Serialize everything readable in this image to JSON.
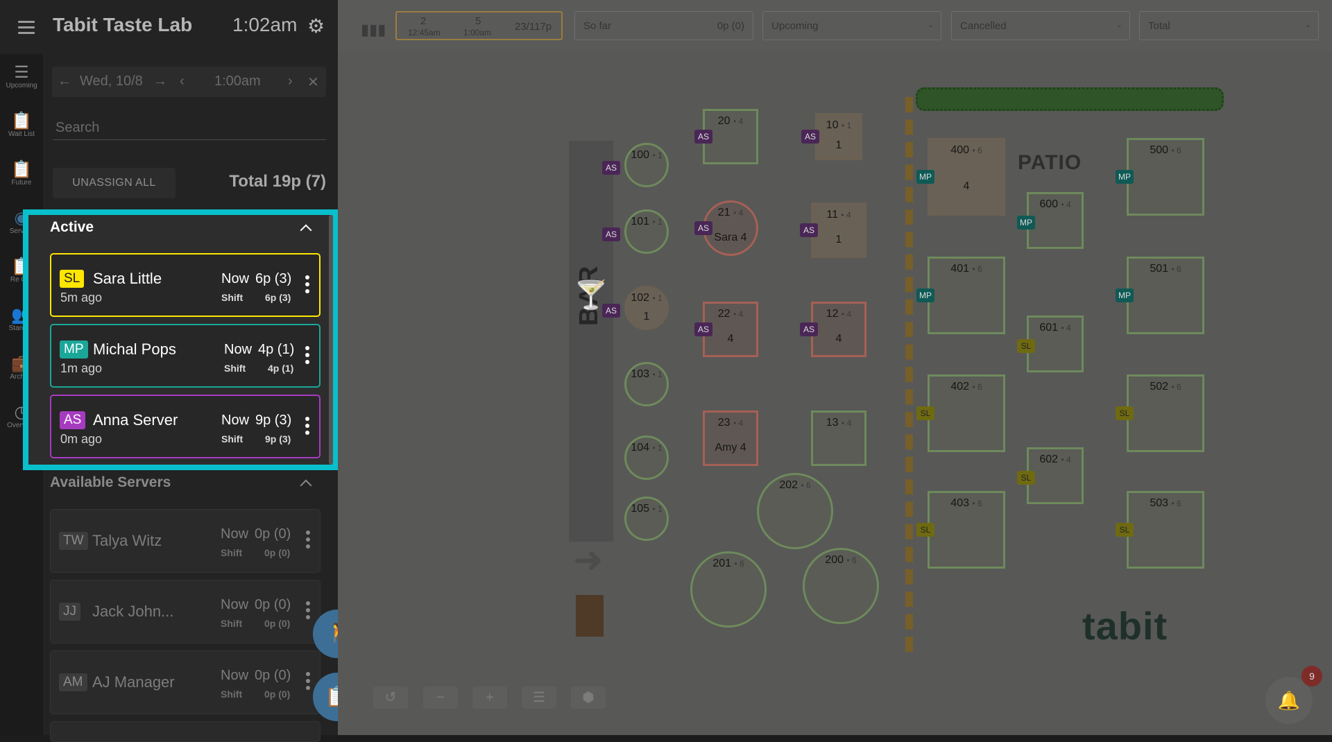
{
  "header": {
    "title": "Tabit Taste Lab",
    "time": "1:02am"
  },
  "rail": [
    {
      "label": "Upcoming"
    },
    {
      "label": "Wait List"
    },
    {
      "label": "Future"
    },
    {
      "label": "Servers"
    },
    {
      "label": "Re Ord"
    },
    {
      "label": "Standby"
    },
    {
      "label": "Archive"
    },
    {
      "label": "Overview"
    }
  ],
  "datebar": {
    "date": "Wed, 10/8",
    "time": "1:00am"
  },
  "search": {
    "placeholder": "Search"
  },
  "actions": {
    "unassign": "UNASSIGN ALL",
    "total": "Total  19p (7)"
  },
  "sections": {
    "active": "Active",
    "available": "Available Servers"
  },
  "active_servers": [
    {
      "initials": "SL",
      "name": "Sara Little",
      "ago": "5m ago",
      "now_label": "Now",
      "now_value": "6p (3)",
      "shift_label": "Shift",
      "shift_value": "6p (3)",
      "color": "#ffe600",
      "text_color": "#222222"
    },
    {
      "initials": "MP",
      "name": "Michal Pops",
      "ago": "1m ago",
      "now_label": "Now",
      "now_value": "4p (1)",
      "shift_label": "Shift",
      "shift_value": "4p (1)",
      "color": "#1aa79a",
      "text_color": "#ffffff"
    },
    {
      "initials": "AS",
      "name": "Anna Server",
      "ago": "0m ago",
      "now_label": "Now",
      "now_value": "9p (3)",
      "shift_label": "Shift",
      "shift_value": "9p (3)",
      "color": "#a73bc0",
      "text_color": "#ffffff"
    }
  ],
  "available_servers": [
    {
      "initials": "TW",
      "name": "Talya Witz",
      "now_label": "Now",
      "now_value": "0p (0)",
      "shift_label": "Shift",
      "shift_value": "0p (0)"
    },
    {
      "initials": "JJ",
      "name": "Jack John...",
      "now_label": "Now",
      "now_value": "0p (0)",
      "shift_label": "Shift",
      "shift_value": "0p (0)"
    },
    {
      "initials": "AM",
      "name": "AJ Manager",
      "now_label": "Now",
      "now_value": "0p (0)",
      "shift_label": "Shift",
      "shift_value": "0p (0)"
    }
  ],
  "map_header": {
    "shift": [
      {
        "count": "2",
        "time": "12:45am"
      },
      {
        "count": "5",
        "time": "1:00am"
      }
    ],
    "covers": "23/117p",
    "so_far": {
      "label": "So far",
      "value": "0p (0)"
    },
    "upcoming": {
      "label": "Upcoming",
      "value": "-"
    },
    "cancelled": {
      "label": "Cancelled",
      "value": "-"
    },
    "total": {
      "label": "Total",
      "value": "-"
    }
  },
  "floor": {
    "bar_label": "BAR",
    "patio_label": "PATIO",
    "logo": "tabit",
    "notifications": "9"
  },
  "tables": [
    {
      "num": "100",
      "seats": "1",
      "tag": "AS"
    },
    {
      "num": "101",
      "seats": "1",
      "tag": "AS"
    },
    {
      "num": "102",
      "seats": "1",
      "tag": "AS",
      "sub": "1"
    },
    {
      "num": "103",
      "seats": "1"
    },
    {
      "num": "104",
      "seats": "1"
    },
    {
      "num": "105",
      "seats": "1"
    },
    {
      "num": "20",
      "seats": "4",
      "tag": "AS"
    },
    {
      "num": "21",
      "seats": "4",
      "tag": "AS",
      "sub": "Sara 4"
    },
    {
      "num": "22",
      "seats": "4",
      "tag": "AS",
      "sub": "4"
    },
    {
      "num": "23",
      "seats": "4",
      "sub": "Amy 4"
    },
    {
      "num": "10",
      "seats": "1",
      "tag": "AS",
      "sub": "1"
    },
    {
      "num": "11",
      "seats": "4",
      "tag": "AS",
      "sub": "1"
    },
    {
      "num": "12",
      "seats": "4",
      "tag": "AS",
      "sub": "4"
    },
    {
      "num": "13",
      "seats": "4"
    },
    {
      "num": "202",
      "seats": "6"
    },
    {
      "num": "201",
      "seats": "6"
    },
    {
      "num": "200",
      "seats": "6"
    },
    {
      "num": "400",
      "seats": "6",
      "tag": "MP",
      "sub": "4"
    },
    {
      "num": "401",
      "seats": "6",
      "tag": "MP"
    },
    {
      "num": "402",
      "seats": "6",
      "tag": "SL"
    },
    {
      "num": "403",
      "seats": "6",
      "tag": "SL"
    },
    {
      "num": "600",
      "seats": "4",
      "tag": "MP"
    },
    {
      "num": "601",
      "seats": "4",
      "tag": "SL"
    },
    {
      "num": "602",
      "seats": "4",
      "tag": "SL"
    },
    {
      "num": "500",
      "seats": "6",
      "tag": "MP"
    },
    {
      "num": "501",
      "seats": "6",
      "tag": "MP"
    },
    {
      "num": "502",
      "seats": "6",
      "tag": "SL"
    },
    {
      "num": "503",
      "seats": "6",
      "tag": "SL"
    }
  ]
}
